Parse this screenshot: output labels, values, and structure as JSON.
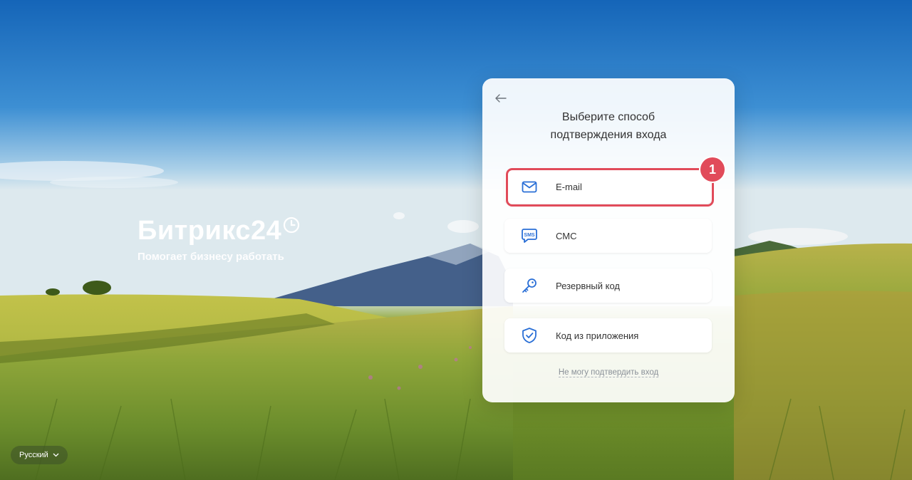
{
  "brand": {
    "logo_text": "Битрикс24",
    "tagline": "Помогает бизнесу работать"
  },
  "language": {
    "selected": "Русский"
  },
  "card": {
    "title_line1": "Выберите способ",
    "title_line2": "подтверждения входа",
    "options": [
      {
        "label": "E-mail",
        "icon": "mail-icon"
      },
      {
        "label": "СМС",
        "icon": "sms-icon"
      },
      {
        "label": "Резервный код",
        "icon": "key-icon"
      },
      {
        "label": "Код из приложения",
        "icon": "shield-check-icon"
      }
    ],
    "cant_confirm_link": "Не могу подтвердить вход"
  },
  "annotation": {
    "badge_number": "1",
    "highlight_color": "#e14b5a"
  },
  "colors": {
    "icon_blue": "#2a6fd6",
    "text": "#333333",
    "link": "#8a9098"
  }
}
